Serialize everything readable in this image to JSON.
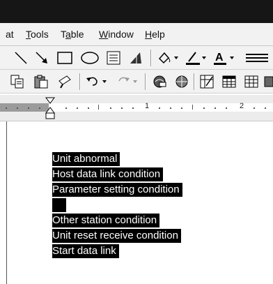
{
  "menu": {
    "items": [
      {
        "label": "at",
        "underline_index": -1
      },
      {
        "label": "Tools",
        "underline_index": 0
      },
      {
        "label": "Table",
        "underline_index": 1
      },
      {
        "label": "Window",
        "underline_index": 0
      },
      {
        "label": "Help",
        "underline_index": 0
      }
    ]
  },
  "ruler": {
    "numbers": [
      "1",
      "2"
    ]
  },
  "document": {
    "selected_lines": [
      "Unit abnormal",
      "Host data link condition",
      "Parameter setting condition",
      "",
      "Other station condition",
      "Unit reset receive condition",
      "Start data link"
    ]
  },
  "colors": {
    "selection_bg": "#000000",
    "selection_fg": "#ffffff",
    "toolbar_bg": "#f2f2f2"
  }
}
